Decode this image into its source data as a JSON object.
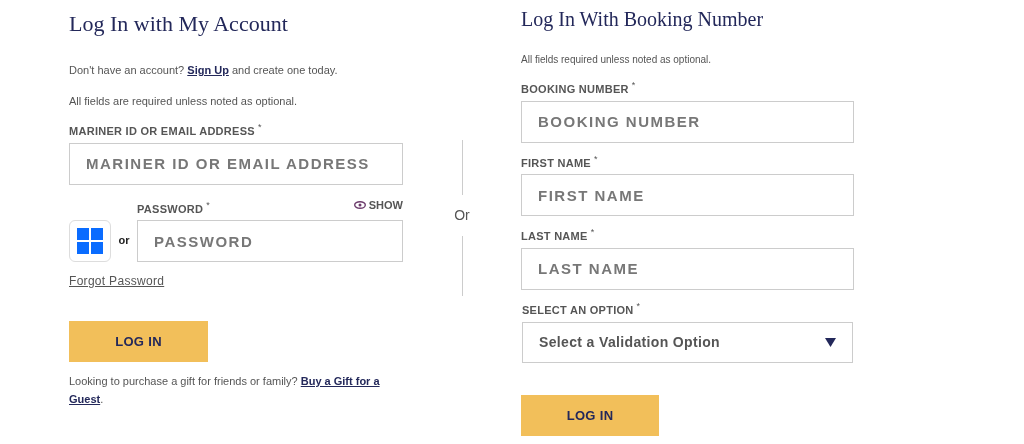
{
  "account_login": {
    "title": "Log In with My Account",
    "signup_text": "Don't have an account? ",
    "signup_link": "Sign Up",
    "signup_suffix": " and create one today.",
    "required_note": "All fields are required unless noted as optional.",
    "id_field": {
      "label": "MARINER ID OR EMAIL ADDRESS",
      "mark": "*",
      "placeholder": "MARINER ID OR EMAIL ADDRESS"
    },
    "password_field": {
      "label": "PASSWORD",
      "mark": "*",
      "placeholder": "PASSWORD",
      "show_toggle": "SHOW"
    },
    "or_small": "or",
    "forgot_link": "Forgot Password",
    "login_button": "LOG IN",
    "gift_text": "Looking to purchase a gift for friends or family? ",
    "gift_link_lines": [
      "Buy a Gift for a",
      "Guest"
    ],
    "gift_suffix": "."
  },
  "separator": "Or",
  "booking_login": {
    "title": "Log In With Booking Number",
    "required_note": "All fields required unless noted as optional.",
    "fields": [
      {
        "kind": "text",
        "label": "BOOKING NUMBER",
        "mark": "*",
        "placeholder": "BOOKING NUMBER"
      },
      {
        "kind": "text",
        "label": "FIRST NAME",
        "mark": "*",
        "placeholder": "FIRST NAME"
      },
      {
        "kind": "text",
        "label": "LAST NAME",
        "mark": "*",
        "placeholder": "LAST NAME"
      },
      {
        "kind": "select",
        "label": "SELECT AN OPTION",
        "mark": "*",
        "value": "Select a Validation Option"
      }
    ],
    "login_button": "LOG IN"
  }
}
